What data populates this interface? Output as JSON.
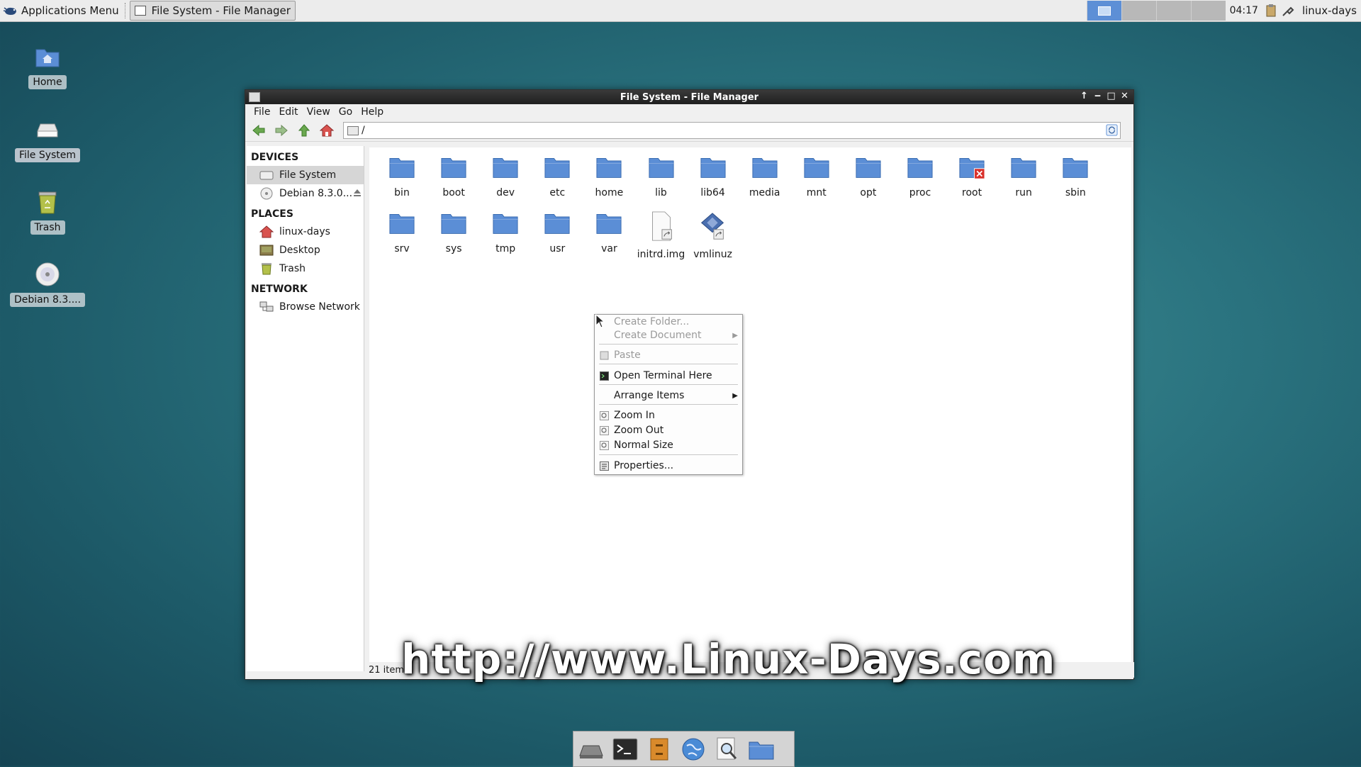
{
  "top_panel": {
    "apps_menu_label": "Applications Menu",
    "task_label": "File System - File Manager",
    "clock": "04:17",
    "user": "linux-days"
  },
  "desktop_icons": [
    {
      "label": "Home",
      "icon": "home-folder-icon"
    },
    {
      "label": "File System",
      "icon": "drive-icon"
    },
    {
      "label": "Trash",
      "icon": "trash-icon"
    },
    {
      "label": "Debian 8.3....",
      "icon": "cdrom-icon"
    }
  ],
  "window": {
    "title": "File System - File Manager",
    "menu": [
      "File",
      "Edit",
      "View",
      "Go",
      "Help"
    ],
    "path": "/",
    "sidebar": {
      "devices_header": "DEVICES",
      "devices": [
        "File System",
        "Debian 8.3.0..."
      ],
      "places_header": "PLACES",
      "places": [
        "linux-days",
        "Desktop",
        "Trash"
      ],
      "network_header": "NETWORK",
      "network": [
        "Browse Network"
      ]
    },
    "files": [
      "bin",
      "boot",
      "dev",
      "etc",
      "home",
      "lib",
      "lib64",
      "media",
      "mnt",
      "opt",
      "proc",
      "root",
      "run",
      "sbin",
      "srv",
      "sys",
      "tmp",
      "usr",
      "var",
      "initrd.img",
      "vmlinuz"
    ],
    "status": "21 item"
  },
  "context_menu": {
    "create_folder": "Create Folder...",
    "create_document": "Create Document",
    "paste": "Paste",
    "open_terminal": "Open Terminal Here",
    "arrange_items": "Arrange Items",
    "zoom_in": "Zoom In",
    "zoom_out": "Zoom Out",
    "normal_size": "Normal Size",
    "properties": "Properties..."
  },
  "watermark": "http://www.Linux-Days.com",
  "colors": {
    "folder_blue": "#5b8ed6",
    "title_dark": "#262626",
    "selection": "#d6d6d6"
  }
}
